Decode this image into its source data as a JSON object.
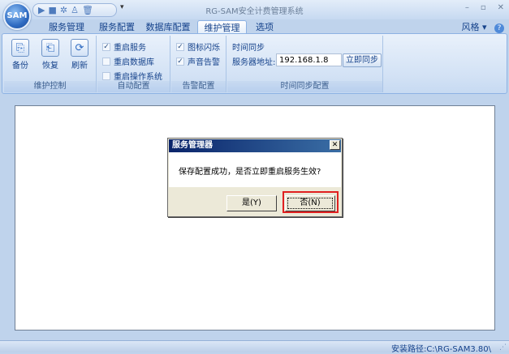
{
  "app": {
    "title": "RG-SAM安全计费管理系统",
    "orb_label": "SAM"
  },
  "quick_access": {
    "items": [
      "play-icon",
      "stop-icon",
      "settings-icon",
      "users-icon",
      "trash-icon"
    ],
    "dropdown": "▾"
  },
  "window_controls": {
    "minimize": "–",
    "restore": "▫",
    "close": "✕"
  },
  "tabs": [
    {
      "label": "服务管理",
      "active": false
    },
    {
      "label": "服务配置",
      "active": false
    },
    {
      "label": "数据库配置",
      "active": false
    },
    {
      "label": "维护管理",
      "active": true
    },
    {
      "label": "选项",
      "active": false
    }
  ],
  "style_menu": {
    "label": "风格",
    "arrow": "▾",
    "help": "?"
  },
  "ribbon": {
    "maintenance_group": {
      "label": "维护控制",
      "buttons": [
        {
          "label": "备份",
          "icon": "backup-icon"
        },
        {
          "label": "恢复",
          "icon": "restore-icon"
        },
        {
          "label": "刷新",
          "icon": "refresh-icon"
        }
      ]
    },
    "auto_group": {
      "label": "自动配置",
      "options": [
        {
          "label": "重启服务",
          "checked": true
        },
        {
          "label": "重启数据库",
          "checked": false
        },
        {
          "label": "重启操作系统",
          "checked": false
        }
      ]
    },
    "alert_group": {
      "label": "告警配置",
      "options": [
        {
          "label": "图标闪烁",
          "checked": true
        },
        {
          "label": "声音告警",
          "checked": true
        }
      ]
    },
    "sync_group": {
      "label": "时间同步配置",
      "heading": "时间同步",
      "server_label": "服务器地址:",
      "server_value": "192.168.1.8",
      "sync_button": "立即同步"
    }
  },
  "dialog": {
    "title": "服务管理器",
    "close": "✕",
    "message": "保存配置成功，是否立即重启服务生效?",
    "yes_label": "是(Y)",
    "no_label": "否(N)"
  },
  "status_bar": {
    "install_path": "安装路径:C:\\RG-SAM3.80\\",
    "grip": "⋰"
  }
}
